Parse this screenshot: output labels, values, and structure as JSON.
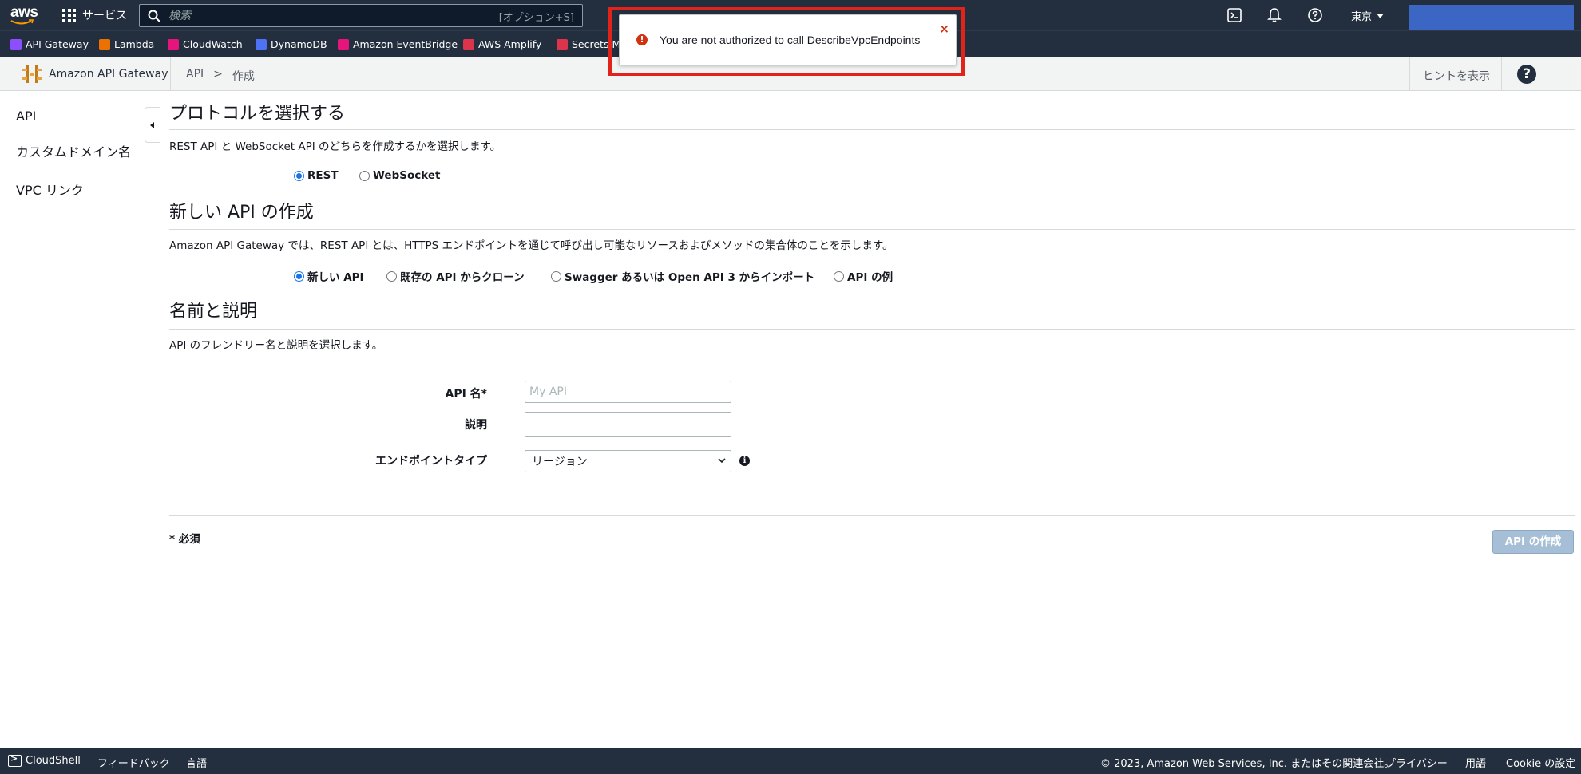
{
  "topnav": {
    "logo_text": "aws",
    "services_label": "サービス",
    "search_placeholder": "検索",
    "search_shortcut": "[オプション+S]",
    "region": "東京"
  },
  "favorites": [
    {
      "label": "API Gateway",
      "color": "#8c4fff"
    },
    {
      "label": "Lambda",
      "color": "#ed7100"
    },
    {
      "label": "CloudWatch",
      "color": "#e7157b"
    },
    {
      "label": "DynamoDB",
      "color": "#4d72f3"
    },
    {
      "label": "Amazon EventBridge",
      "color": "#e7157b"
    },
    {
      "label": "AWS Amplify",
      "color": "#dd344c"
    },
    {
      "label": "Secrets Ma",
      "color": "#dd344c"
    }
  ],
  "crumbbar": {
    "service_name": "Amazon API Gateway",
    "crumb_api": "API",
    "crumb_sep": ">",
    "crumb_create": "作成",
    "hint_label": "ヒントを表示",
    "help_label": "?"
  },
  "sidebar": {
    "items": [
      {
        "label": "API"
      },
      {
        "label": "カスタムドメイン名"
      },
      {
        "label": "VPC リンク"
      }
    ]
  },
  "protocol": {
    "heading": "プロトコルを選択する",
    "description": "REST API と WebSocket API のどちらを作成するかを選択します。",
    "options": [
      {
        "label": "REST",
        "selected": true
      },
      {
        "label": "WebSocket",
        "selected": false
      }
    ]
  },
  "create_api": {
    "heading": "新しい API の作成",
    "description": "Amazon API Gateway では、REST API とは、HTTPS エンドポイントを通じて呼び出し可能なリソースおよびメソッドの集合体のことを示します。",
    "options": [
      {
        "label": "新しい API",
        "selected": true
      },
      {
        "label": "既存の API からクローン",
        "selected": false
      },
      {
        "label": "Swagger あるいは Open API 3 からインポート",
        "selected": false
      },
      {
        "label": "API の例",
        "selected": false
      }
    ]
  },
  "name_desc": {
    "heading": "名前と説明",
    "description": "API のフレンドリー名と説明を選択します。",
    "api_name_label": "API 名*",
    "api_name_placeholder": "My API",
    "api_name_value": "",
    "desc_label": "説明",
    "desc_value": "",
    "endpoint_label": "エンドポイントタイプ",
    "endpoint_value": "リージョン"
  },
  "footer_form": {
    "required_note": "* 必須",
    "create_button": "API の作成"
  },
  "toast": {
    "message": "You are not authorized to call DescribeVpcEndpoints",
    "close": "×"
  },
  "footer": {
    "cloudshell": "CloudShell",
    "feedback": "フィードバック",
    "language": "言語",
    "copyright": "© 2023, Amazon Web Services, Inc. またはその関連会社。",
    "privacy": "プライバシー",
    "terms": "用語",
    "cookie": "Cookie の設定"
  },
  "colors": {
    "nav_bg": "#232f3e",
    "error": "#d13212",
    "highlight": "#e2231a",
    "button_disabled": "#a7bfd6",
    "account_box": "#3b66c4"
  }
}
